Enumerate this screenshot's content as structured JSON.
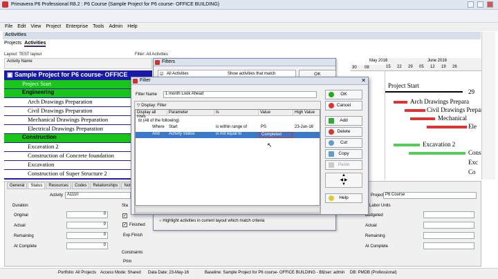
{
  "window": {
    "title": "Primavera P6 Professional R8.2 : P6 Course (Sample Project for P6 course- OFFICE BUILDING)"
  },
  "menu": [
    "File",
    "Edit",
    "View",
    "Project",
    "Enterprise",
    "Tools",
    "Admin",
    "Help"
  ],
  "activities_bar": "Activities",
  "tabs": [
    "Projects",
    "Activities"
  ],
  "layout_label": "Layout: TEST layout",
  "filter_label": "Filter: All Activities",
  "activity_name_hdr": "Activity Name",
  "project_row": "Sample Project for P6 course- OFFICE",
  "rows": [
    {
      "type": "start",
      "text": "Project Start"
    },
    {
      "type": "wbs",
      "text": "Engineering"
    },
    {
      "type": "act",
      "text": "Arch Drawings Preparation"
    },
    {
      "type": "act",
      "text": "Civil Drawings Preparation"
    },
    {
      "type": "act",
      "text": "Mechanical  Drawings Preparation"
    },
    {
      "type": "act",
      "text": "Electrical Drawings Preparation"
    },
    {
      "type": "wbs",
      "text": "Construction"
    },
    {
      "type": "act",
      "text": "Excavation 2"
    },
    {
      "type": "act",
      "text": "Construction of Concrete foundation"
    },
    {
      "type": "act",
      "text": "Excavation"
    },
    {
      "type": "act",
      "text": "Construction of Super Structure 2"
    }
  ],
  "gantt": {
    "months": [
      "May 2016",
      "June 2016"
    ],
    "days": [
      "30",
      "08",
      "15",
      "22",
      "29",
      "05",
      "12",
      "19",
      "26"
    ],
    "labels": [
      "Project Start",
      "29",
      "Arch Drawings Prepara",
      "Civil Drawings Prepar",
      "Mechanical",
      "Ele",
      "Excavation 2",
      "Constru",
      "Exc",
      "Co"
    ]
  },
  "bottom": {
    "tabs": [
      "General",
      "Status",
      "Resources",
      "Codes",
      "Relationships",
      "Notebook"
    ],
    "activity_label": "Activity",
    "activity_value": "A1110",
    "duration": "Duration",
    "original": "Original",
    "actual": "Actual",
    "remaining": "Remaining",
    "at_complete": "At Complete",
    "zero": "0",
    "sta": "Sta",
    "finished": "Finished",
    "exp_finish": "Exp Finish",
    "constraints": "Constraints",
    "primary": "Prim",
    "project_label": "Project",
    "project_value": "P6 Course",
    "labor_units": "Labor Units",
    "budgeted": "Budgeted"
  },
  "status": {
    "portfolio": "Portfolio: All Projects",
    "access": "Access Mode: Shared",
    "date": "Data Date: 23-May-16",
    "baseline": "Baseline: Sample Project for P6 course- OFFICE BUILDING - B1",
    "user": "User: admin",
    "db": "DB: PMDB (Professional)"
  },
  "filters_dlg": {
    "title": "Filters",
    "col1": "All Activities",
    "col2": "Show activities that match",
    "ok": "OK",
    "highlight": "Highlight activities in current layout which match criteria"
  },
  "filter_dlg": {
    "title": "Filter",
    "name_label": "Filter Name",
    "name_value": "1 month Look Ahead",
    "display_label": "Display: Filter",
    "headers": [
      "Display all rows",
      "Parameter",
      "Is",
      "Value",
      "High Value"
    ],
    "root": "(All of the following)",
    "rows": [
      {
        "op": "Where",
        "param": "Start",
        "is": "is within range of",
        "val": "PS",
        "high": "23-Jun-16"
      },
      {
        "op": "And",
        "param": "Activity Status",
        "is": "is not equal to",
        "val": "Completed",
        "high": ""
      }
    ],
    "buttons": [
      "OK",
      "Cancel",
      "Add",
      "Delete",
      "Cut",
      "Copy",
      "Paste",
      "Help"
    ]
  }
}
